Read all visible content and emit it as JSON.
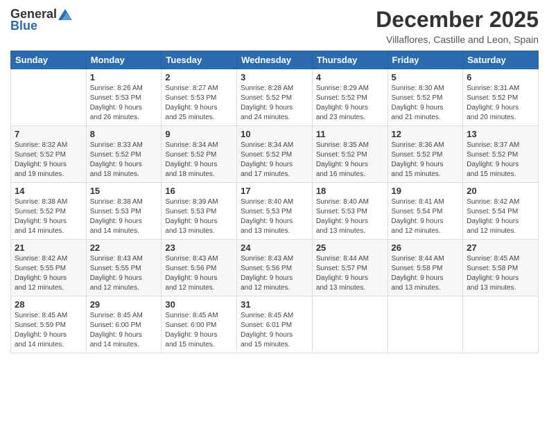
{
  "logo": {
    "general": "General",
    "blue": "Blue"
  },
  "title": "December 2025",
  "location": "Villaflores, Castille and Leon, Spain",
  "weekdays": [
    "Sunday",
    "Monday",
    "Tuesday",
    "Wednesday",
    "Thursday",
    "Friday",
    "Saturday"
  ],
  "weeks": [
    [
      {
        "day": "",
        "info": ""
      },
      {
        "day": "1",
        "info": "Sunrise: 8:26 AM\nSunset: 5:53 PM\nDaylight: 9 hours\nand 26 minutes."
      },
      {
        "day": "2",
        "info": "Sunrise: 8:27 AM\nSunset: 5:53 PM\nDaylight: 9 hours\nand 25 minutes."
      },
      {
        "day": "3",
        "info": "Sunrise: 8:28 AM\nSunset: 5:52 PM\nDaylight: 9 hours\nand 24 minutes."
      },
      {
        "day": "4",
        "info": "Sunrise: 8:29 AM\nSunset: 5:52 PM\nDaylight: 9 hours\nand 23 minutes."
      },
      {
        "day": "5",
        "info": "Sunrise: 8:30 AM\nSunset: 5:52 PM\nDaylight: 9 hours\nand 21 minutes."
      },
      {
        "day": "6",
        "info": "Sunrise: 8:31 AM\nSunset: 5:52 PM\nDaylight: 9 hours\nand 20 minutes."
      }
    ],
    [
      {
        "day": "7",
        "info": "Sunrise: 8:32 AM\nSunset: 5:52 PM\nDaylight: 9 hours\nand 19 minutes."
      },
      {
        "day": "8",
        "info": "Sunrise: 8:33 AM\nSunset: 5:52 PM\nDaylight: 9 hours\nand 18 minutes."
      },
      {
        "day": "9",
        "info": "Sunrise: 8:34 AM\nSunset: 5:52 PM\nDaylight: 9 hours\nand 18 minutes."
      },
      {
        "day": "10",
        "info": "Sunrise: 8:34 AM\nSunset: 5:52 PM\nDaylight: 9 hours\nand 17 minutes."
      },
      {
        "day": "11",
        "info": "Sunrise: 8:35 AM\nSunset: 5:52 PM\nDaylight: 9 hours\nand 16 minutes."
      },
      {
        "day": "12",
        "info": "Sunrise: 8:36 AM\nSunset: 5:52 PM\nDaylight: 9 hours\nand 15 minutes."
      },
      {
        "day": "13",
        "info": "Sunrise: 8:37 AM\nSunset: 5:52 PM\nDaylight: 9 hours\nand 15 minutes."
      }
    ],
    [
      {
        "day": "14",
        "info": "Sunrise: 8:38 AM\nSunset: 5:52 PM\nDaylight: 9 hours\nand 14 minutes."
      },
      {
        "day": "15",
        "info": "Sunrise: 8:38 AM\nSunset: 5:53 PM\nDaylight: 9 hours\nand 14 minutes."
      },
      {
        "day": "16",
        "info": "Sunrise: 8:39 AM\nSunset: 5:53 PM\nDaylight: 9 hours\nand 13 minutes."
      },
      {
        "day": "17",
        "info": "Sunrise: 8:40 AM\nSunset: 5:53 PM\nDaylight: 9 hours\nand 13 minutes."
      },
      {
        "day": "18",
        "info": "Sunrise: 8:40 AM\nSunset: 5:53 PM\nDaylight: 9 hours\nand 13 minutes."
      },
      {
        "day": "19",
        "info": "Sunrise: 8:41 AM\nSunset: 5:54 PM\nDaylight: 9 hours\nand 12 minutes."
      },
      {
        "day": "20",
        "info": "Sunrise: 8:42 AM\nSunset: 5:54 PM\nDaylight: 9 hours\nand 12 minutes."
      }
    ],
    [
      {
        "day": "21",
        "info": "Sunrise: 8:42 AM\nSunset: 5:55 PM\nDaylight: 9 hours\nand 12 minutes."
      },
      {
        "day": "22",
        "info": "Sunrise: 8:43 AM\nSunset: 5:55 PM\nDaylight: 9 hours\nand 12 minutes."
      },
      {
        "day": "23",
        "info": "Sunrise: 8:43 AM\nSunset: 5:56 PM\nDaylight: 9 hours\nand 12 minutes."
      },
      {
        "day": "24",
        "info": "Sunrise: 8:43 AM\nSunset: 5:56 PM\nDaylight: 9 hours\nand 12 minutes."
      },
      {
        "day": "25",
        "info": "Sunrise: 8:44 AM\nSunset: 5:57 PM\nDaylight: 9 hours\nand 13 minutes."
      },
      {
        "day": "26",
        "info": "Sunrise: 8:44 AM\nSunset: 5:58 PM\nDaylight: 9 hours\nand 13 minutes."
      },
      {
        "day": "27",
        "info": "Sunrise: 8:45 AM\nSunset: 5:58 PM\nDaylight: 9 hours\nand 13 minutes."
      }
    ],
    [
      {
        "day": "28",
        "info": "Sunrise: 8:45 AM\nSunset: 5:59 PM\nDaylight: 9 hours\nand 14 minutes."
      },
      {
        "day": "29",
        "info": "Sunrise: 8:45 AM\nSunset: 6:00 PM\nDaylight: 9 hours\nand 14 minutes."
      },
      {
        "day": "30",
        "info": "Sunrise: 8:45 AM\nSunset: 6:00 PM\nDaylight: 9 hours\nand 15 minutes."
      },
      {
        "day": "31",
        "info": "Sunrise: 8:45 AM\nSunset: 6:01 PM\nDaylight: 9 hours\nand 15 minutes."
      },
      {
        "day": "",
        "info": ""
      },
      {
        "day": "",
        "info": ""
      },
      {
        "day": "",
        "info": ""
      }
    ]
  ]
}
